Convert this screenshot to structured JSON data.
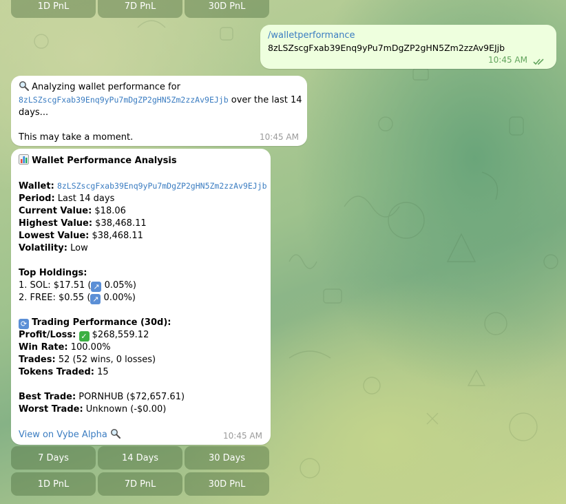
{
  "keyboard_top": {
    "buttons": [
      "1D PnL",
      "7D PnL",
      "30D PnL"
    ]
  },
  "user_message": {
    "command": "/walletperformance",
    "address": "8zLSZscgFxab39Enq9yPu7mDgZP2gHN5Zm2zzAv9EJjb",
    "time": "10:45 AM"
  },
  "bot_message_1": {
    "icon": "magnifier-icon",
    "prefix": "Analyzing wallet performance for",
    "address": "8zLSZscgFxab39Enq9yPu7mDgZP2gHN5Zm2zzAv9EJjb",
    "suffix": " over the last 14",
    "suffix2": "days...",
    "note": "This may take a moment.",
    "time": "10:45 AM"
  },
  "bot_message_2": {
    "title": "Wallet Performance Analysis",
    "wallet_label": "Wallet:",
    "wallet_address": "8zLSZscgFxab39Enq9yPu7mDgZP2gHN5Zm2zzAv9EJjb",
    "period_label": "Period:",
    "period_value": " Last 14 days",
    "current_label": "Current Value:",
    "current_value": " $18.06",
    "highest_label": "Highest Value:",
    "highest_value": " $38,468.11",
    "lowest_label": "Lowest Value:",
    "lowest_value": " $38,468.11",
    "volatility_label": "Volatility:",
    "volatility_value": " Low",
    "holdings_title": "Top Holdings:",
    "holdings": [
      {
        "prefix": "1. SOL: $17.51 (",
        "suffix": " 0.05%)"
      },
      {
        "prefix": "2. FREE: $0.55 (",
        "suffix": " 0.00%)"
      }
    ],
    "trading_title": "Trading Performance (30d):",
    "pnl_label": "Profit/Loss:",
    "pnl_value": " $268,559.12",
    "winrate_label": "Win Rate:",
    "winrate_value": " 100.00%",
    "trades_label": "Trades:",
    "trades_value": " 52 (52 wins, 0 losses)",
    "tokens_label": "Tokens Traded:",
    "tokens_value": " 15",
    "best_label": "Best Trade:",
    "best_value": " PORNHUB ($72,657.61)",
    "worst_label": "Worst Trade:",
    "worst_value": " Unknown (-$0.00)",
    "link_text": "View on Vybe Alpha",
    "time": "10:45 AM"
  },
  "keyboard_bottom": {
    "row1": [
      "7 Days",
      "14 Days",
      "30 Days"
    ],
    "row2": [
      "1D PnL",
      "7D PnL",
      "30D PnL"
    ]
  },
  "colors": {
    "outgoing_bubble": "#eeffde",
    "incoming_bubble": "#ffffff",
    "link": "#3a7cc1",
    "check_green": "#61a35c"
  }
}
